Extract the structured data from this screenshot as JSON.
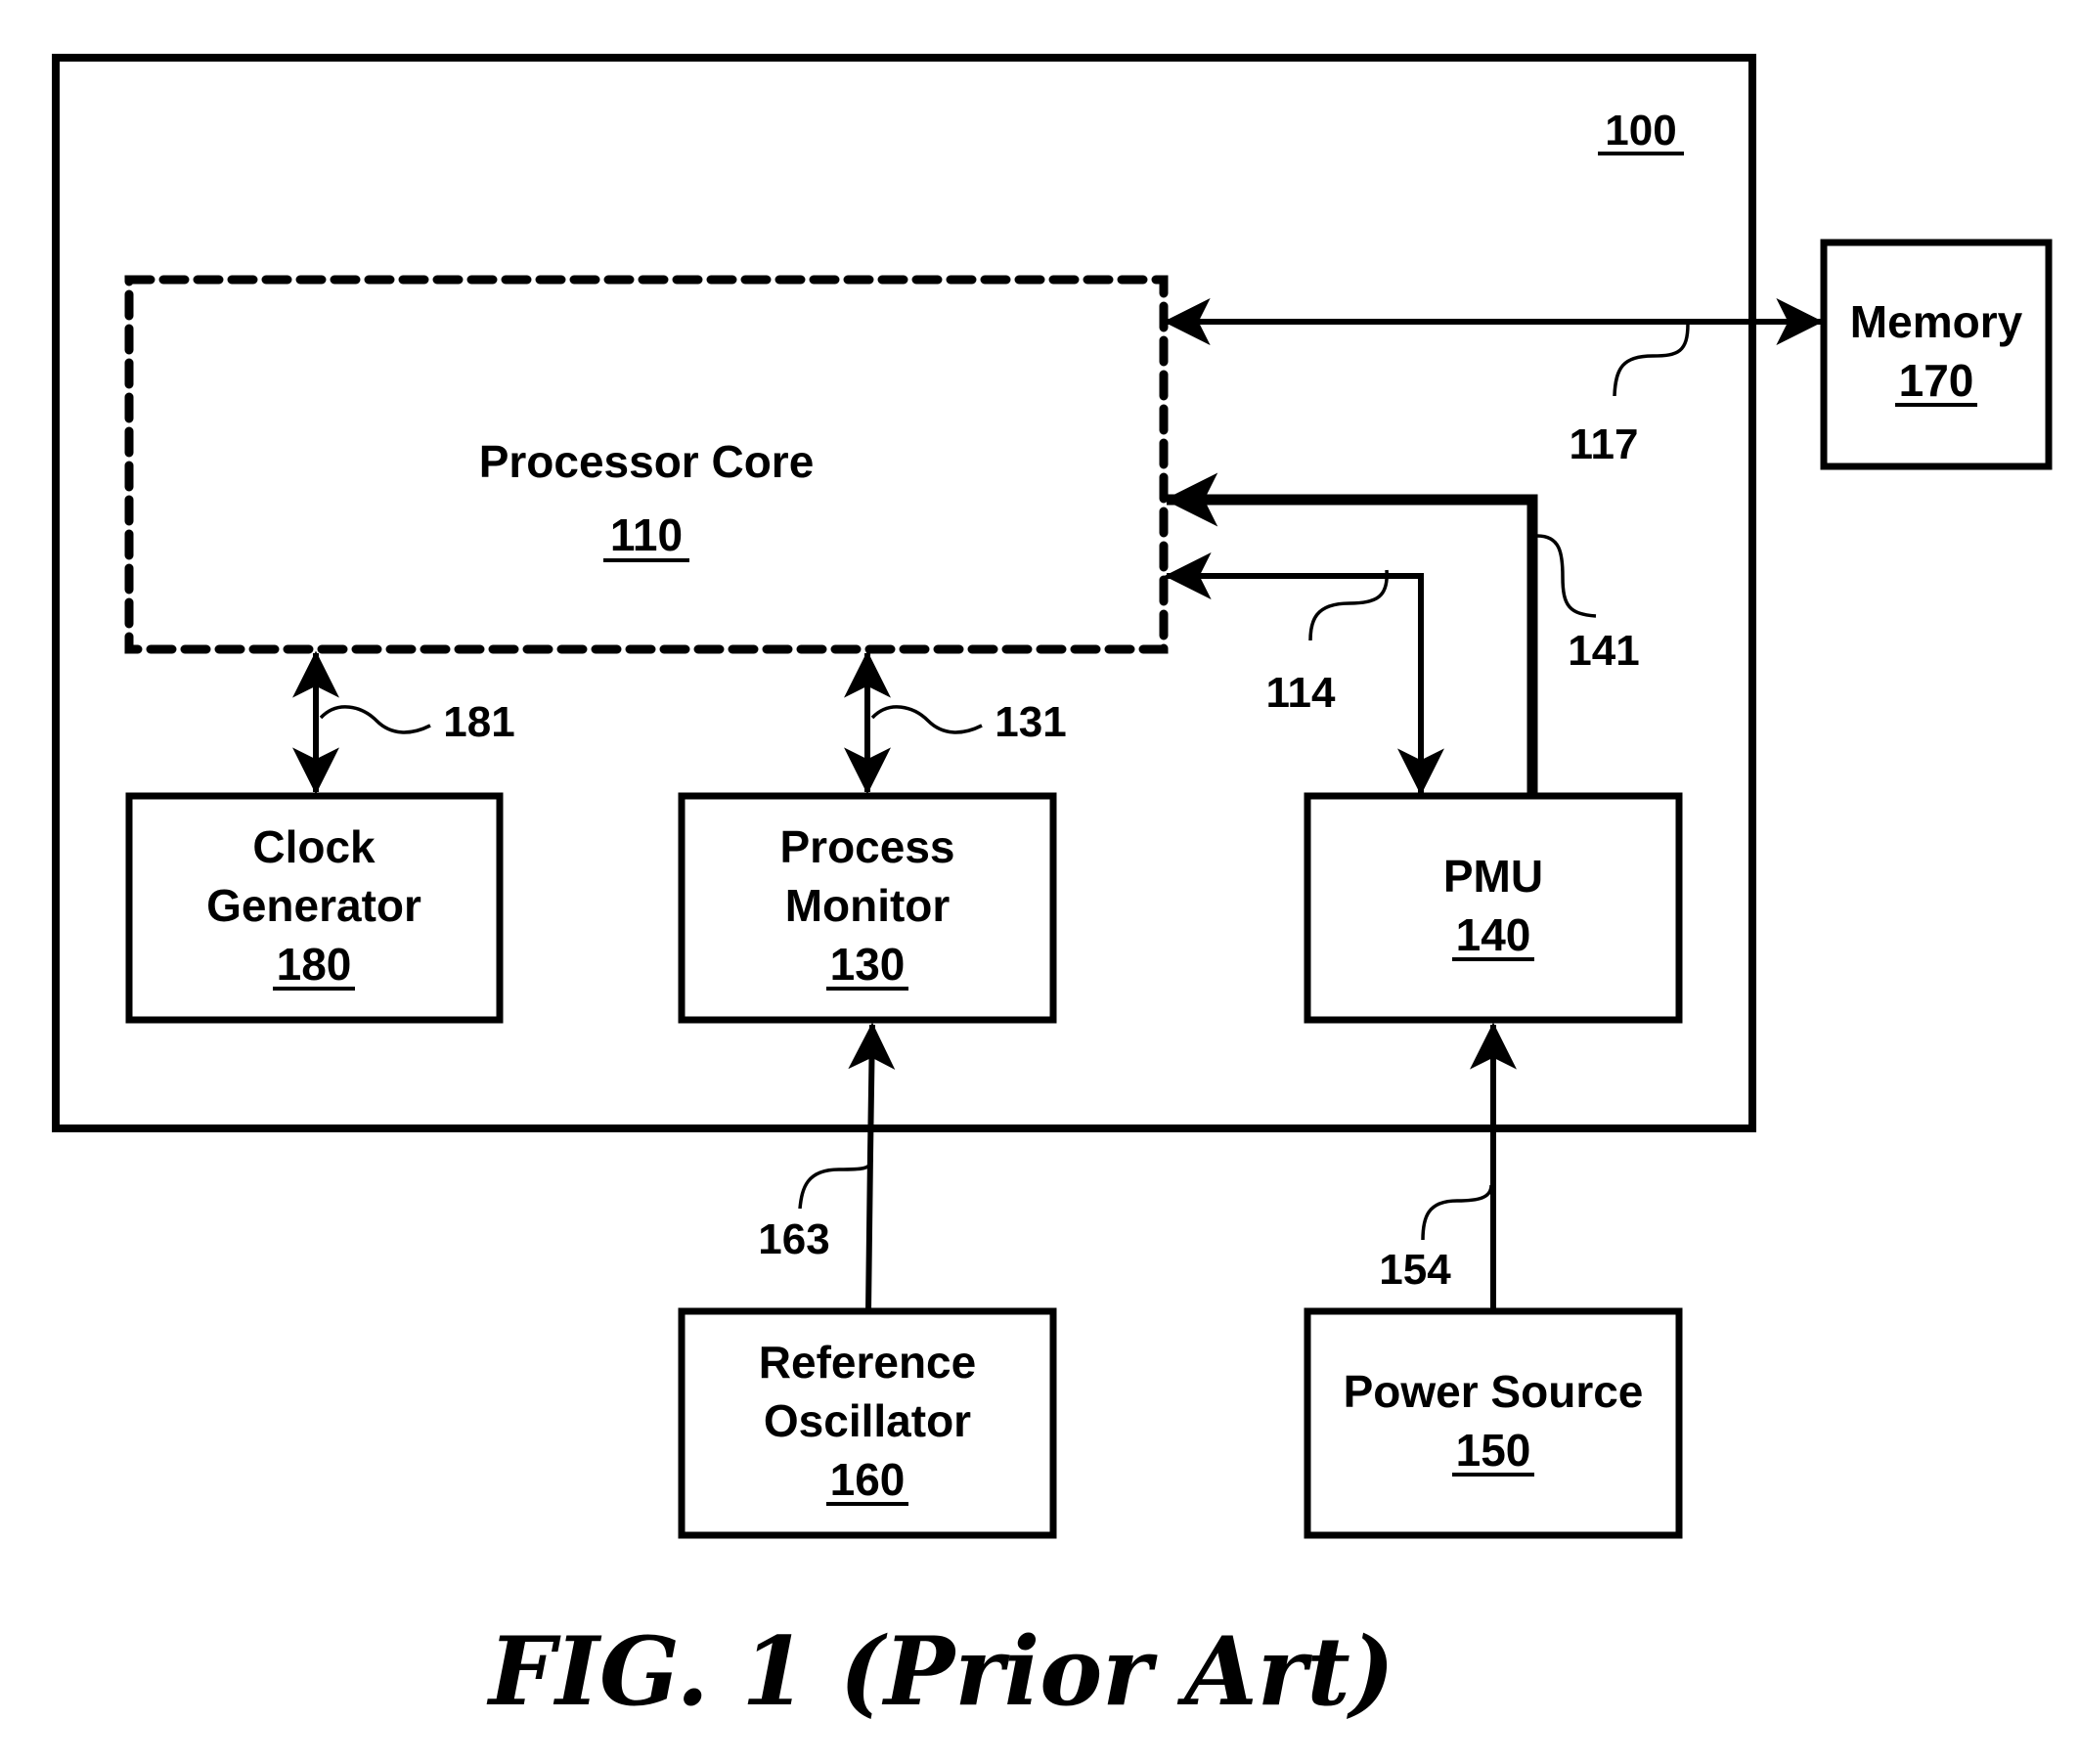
{
  "diagram": {
    "system": {
      "ref": "100"
    },
    "blocks": {
      "processor_core": {
        "title": "Processor Core",
        "ref": "110"
      },
      "clock_generator": {
        "line1": "Clock",
        "line2": "Generator",
        "ref": "180"
      },
      "process_monitor": {
        "line1": "Process",
        "line2": "Monitor",
        "ref": "130"
      },
      "pmu": {
        "title": "PMU",
        "ref": "140"
      },
      "memory": {
        "title": "Memory",
        "ref": "170"
      },
      "reference_oscillator": {
        "line1": "Reference",
        "line2": "Oscillator",
        "ref": "160"
      },
      "power_source": {
        "title": "Power Source",
        "ref": "150"
      }
    },
    "connections": {
      "c117": {
        "ref": "117",
        "from": "Processor Core",
        "to": "Memory",
        "direction": "bidirectional"
      },
      "c141": {
        "ref": "141",
        "from": "PMU",
        "to": "Processor Core",
        "direction": "to-core"
      },
      "c114": {
        "ref": "114",
        "from": "Processor Core",
        "to": "PMU",
        "direction": "to-pmu"
      },
      "c181": {
        "ref": "181",
        "from": "Clock Generator",
        "to": "Processor Core",
        "direction": "bidirectional"
      },
      "c131": {
        "ref": "131",
        "from": "Process Monitor",
        "to": "Processor Core",
        "direction": "bidirectional"
      },
      "c163": {
        "ref": "163",
        "from": "Reference Oscillator",
        "to": "Process Monitor",
        "direction": "to-monitor"
      },
      "c154": {
        "ref": "154",
        "from": "Power Source",
        "to": "PMU",
        "direction": "to-pmu"
      }
    },
    "caption": "FIG. 1 (Prior Art)"
  }
}
